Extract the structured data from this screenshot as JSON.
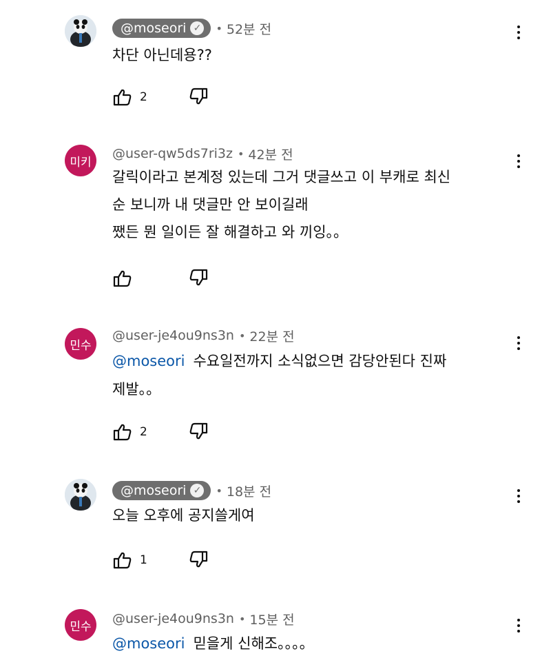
{
  "comments": [
    {
      "handle": "@moseori",
      "verified": true,
      "time": "52분 전",
      "lines": [
        "차단 아닌데용??"
      ],
      "likes": "2"
    },
    {
      "avatar_text": "미키",
      "avatar_color": "#c2185b",
      "handle": "@user-qw5ds7ri3z",
      "verified": false,
      "time": "42분 전",
      "lines": [
        "갈릭이라고 본계정 있는데 그거 댓글쓰고 이 부캐로 최신",
        "순 보니까 내 댓글만 안 보이길래",
        "쨌든 뭔 일이든 잘 해결하고 와 끼잉。。"
      ],
      "likes": ""
    },
    {
      "avatar_text": "민수",
      "avatar_color": "#c2185b",
      "handle": "@user-je4ou9ns3n",
      "verified": false,
      "time": "22분 전",
      "mention": "@moseori",
      "lines": [
        "수요일전까지 소식없으면 감당안된다 진짜",
        "제발。。"
      ],
      "likes": "2"
    },
    {
      "handle": "@moseori",
      "verified": true,
      "time": "18분 전",
      "lines": [
        "오늘 오후에 공지쓸게여"
      ],
      "likes": "1"
    },
    {
      "avatar_text": "민수",
      "avatar_color": "#c2185b",
      "handle": "@user-je4ou9ns3n",
      "verified": false,
      "time": "15분 전",
      "mention": "@moseori",
      "lines": [
        "믿을게 신해조。。。。"
      ],
      "likes": ""
    }
  ],
  "icons": {
    "like": "thumbs-up-icon",
    "dislike": "thumbs-down-icon",
    "more": "more-vert-icon",
    "verified": "verified-check-icon"
  },
  "colors": {
    "handle_chip": "#6e6e6e",
    "mention": "#0b57a8",
    "avatar": "#c2185b"
  }
}
